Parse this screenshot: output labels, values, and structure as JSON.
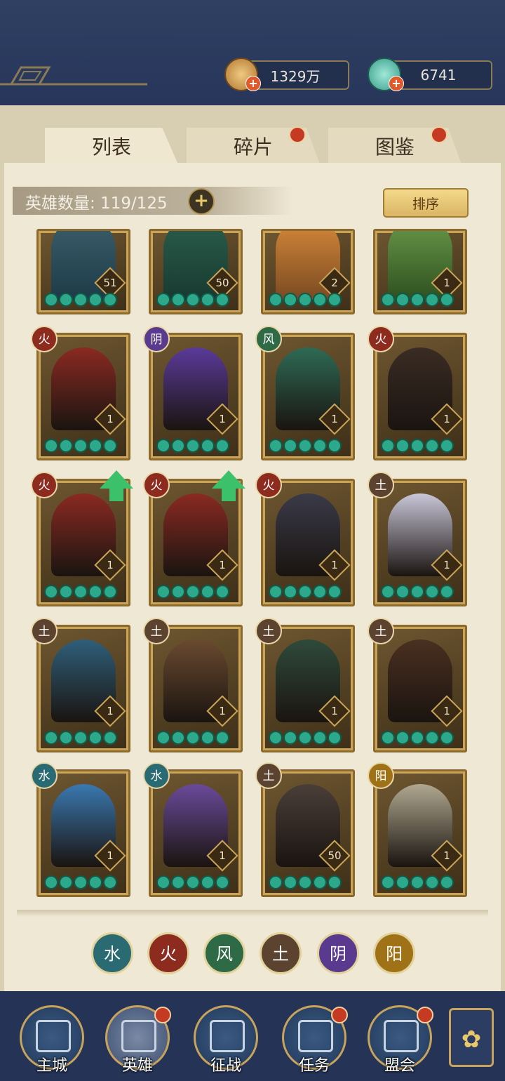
{
  "currency": {
    "copper": "1329万",
    "jade": "6741"
  },
  "tabs": [
    {
      "label": "列表",
      "active": true,
      "badge": false
    },
    {
      "label": "碎片",
      "active": false,
      "badge": true
    },
    {
      "label": "图鉴",
      "active": false,
      "badge": true
    }
  ],
  "hero_count": {
    "label": "英雄数量: 119/125"
  },
  "sort_label": "排序",
  "partial_row_levels": [
    "51",
    "50",
    "2",
    "1"
  ],
  "heroes": [
    {
      "element": "火",
      "level": "1"
    },
    {
      "element": "阴",
      "level": "1"
    },
    {
      "element": "风",
      "level": "1"
    },
    {
      "element": "火",
      "level": "1"
    },
    {
      "element": "火",
      "level": "1",
      "upgrade": true
    },
    {
      "element": "火",
      "level": "1",
      "upgrade": true
    },
    {
      "element": "火",
      "level": "1"
    },
    {
      "element": "土",
      "level": "1"
    },
    {
      "element": "土",
      "level": "1"
    },
    {
      "element": "土",
      "level": "1"
    },
    {
      "element": "土",
      "level": "1"
    },
    {
      "element": "土",
      "level": "1"
    },
    {
      "element": "水",
      "level": "1"
    },
    {
      "element": "水",
      "level": "1"
    },
    {
      "element": "土",
      "level": "50"
    },
    {
      "element": "阳",
      "level": "1"
    }
  ],
  "filters": [
    "水",
    "火",
    "风",
    "土",
    "阴",
    "阳"
  ],
  "nav": [
    {
      "label": "主城",
      "badge": false
    },
    {
      "label": "英雄",
      "badge": true,
      "active": true
    },
    {
      "label": "征战",
      "badge": false
    },
    {
      "label": "任务",
      "badge": true
    },
    {
      "label": "盟会",
      "badge": true
    }
  ],
  "colors": {
    "fire": "#8e2b1f",
    "yin": "#5a3a8e",
    "wind": "#2e6a45",
    "earth": "#5b4330",
    "water": "#2a6a72",
    "yang": "#a07218",
    "badge": "#c53a22"
  }
}
